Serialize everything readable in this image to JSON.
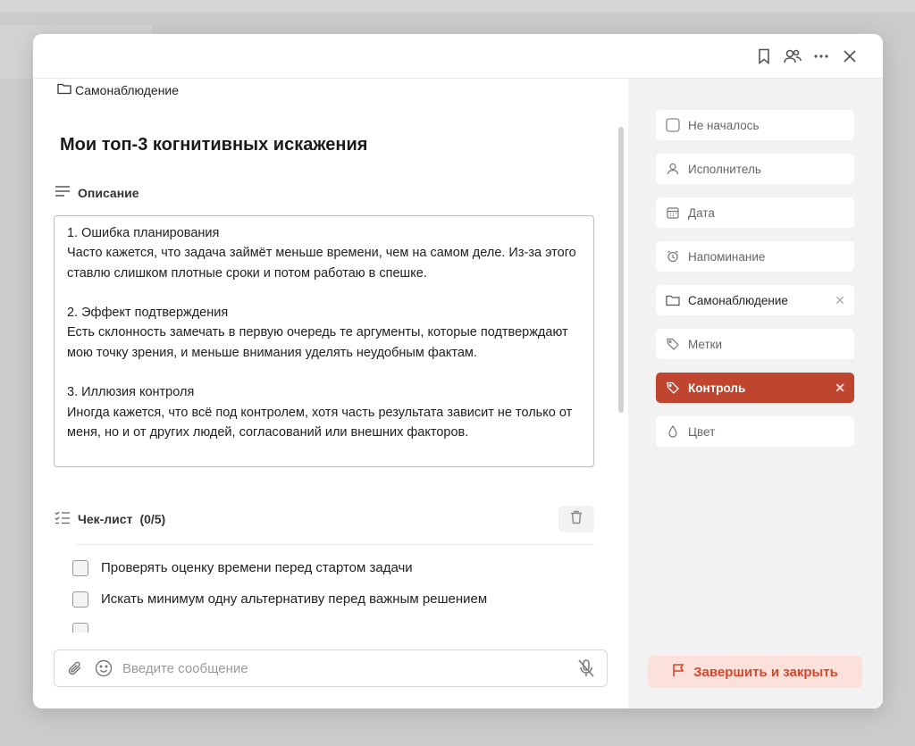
{
  "header": {
    "bookmark_icon": "bookmark-icon",
    "members_icon": "members-icon",
    "more_icon": "more-icon",
    "close_icon": "close-icon"
  },
  "task": {
    "folder": "Самонаблюдение",
    "title": "Мои топ-3 когнитивных искажения",
    "description_label": "Описание",
    "description": "1. Ошибка планирования\nЧасто кажется, что задача займёт меньше времени, чем на самом деле. Из-за этого ставлю слишком плотные сроки и потом работаю в спешке.\n\n2. Эффект подтверждения\nЕсть склонность замечать в первую очередь те аргументы, которые подтверждают мою точку зрения, и меньше внимания уделять неудобным фактам.\n\n3. Иллюзия контроля\nИногда кажется, что всё под контролем, хотя часть результата зависит не только от меня, но и от других людей, согласований или внешних факторов."
  },
  "checklist": {
    "label": "Чек-лист",
    "count": "(0/5)",
    "items": [
      {
        "text": "Проверять оценку времени перед стартом задачи"
      },
      {
        "text": "Искать минимум одну альтернативу перед важным решением"
      }
    ]
  },
  "message": {
    "placeholder": "Введите сообщение"
  },
  "properties": {
    "status": "Не началось",
    "assignee": "Исполнитель",
    "date": "Дата",
    "reminder": "Напоминание",
    "folder": "Самонаблюдение",
    "tags": "Метки",
    "tag_control": "Контроль",
    "color": "Цвет"
  },
  "finish_button": "Завершить и закрыть",
  "colors": {
    "accent": "#c0452f",
    "finish_bg": "#fbe1d9",
    "finish_text": "#d2492f"
  }
}
